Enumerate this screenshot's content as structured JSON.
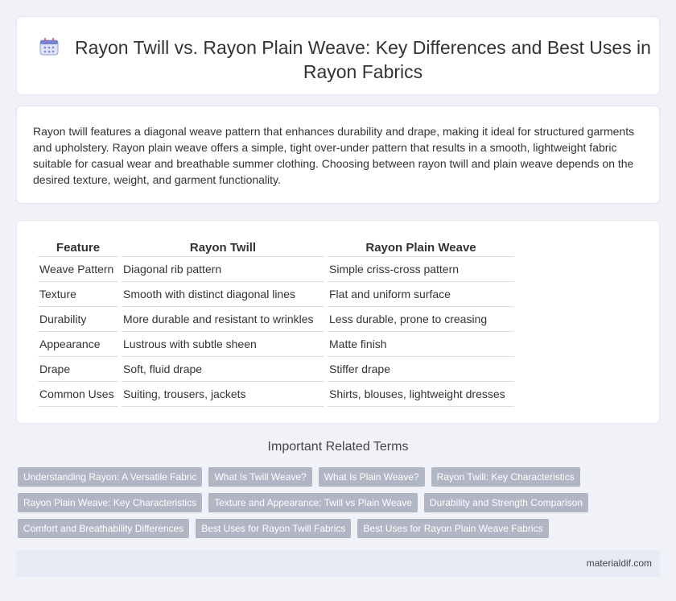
{
  "header": {
    "icon": "calendar-icon",
    "title": "Rayon Twill vs. Rayon Plain Weave: Key Differences and Best Uses in Rayon Fabrics"
  },
  "intro": {
    "text": "Rayon twill features a diagonal weave pattern that enhances durability and drape, making it ideal for structured garments and upholstery. Rayon plain weave offers a simple, tight over-under pattern that results in a smooth, lightweight fabric suitable for casual wear and breathable summer clothing. Choosing between rayon twill and plain weave depends on the desired texture, weight, and garment functionality."
  },
  "table": {
    "headers": [
      "Feature",
      "Rayon Twill",
      "Rayon Plain Weave"
    ],
    "rows": [
      [
        "Weave Pattern",
        "Diagonal rib pattern",
        "Simple criss-cross pattern"
      ],
      [
        "Texture",
        "Smooth with distinct diagonal lines",
        "Flat and uniform surface"
      ],
      [
        "Durability",
        "More durable and resistant to wrinkles",
        "Less durable, prone to creasing"
      ],
      [
        "Appearance",
        "Lustrous with subtle sheen",
        "Matte finish"
      ],
      [
        "Drape",
        "Soft, fluid drape",
        "Stiffer drape"
      ],
      [
        "Common Uses",
        "Suiting, trousers, jackets",
        "Shirts, blouses, lightweight dresses"
      ]
    ]
  },
  "related": {
    "title": "Important Related Terms",
    "tags": [
      "Understanding Rayon: A Versatile Fabric",
      "What Is Twill Weave?",
      "What Is Plain Weave?",
      "Rayon Twill: Key Characteristics",
      "Rayon Plain Weave: Key Characteristics",
      "Texture and Appearance: Twill vs Plain Weave",
      "Durability and Strength Comparison",
      "Comfort and Breathability Differences",
      "Best Uses for Rayon Twill Fabrics",
      "Best Uses for Rayon Plain Weave Fabrics"
    ]
  },
  "footer": {
    "site": "materialdif.com"
  }
}
